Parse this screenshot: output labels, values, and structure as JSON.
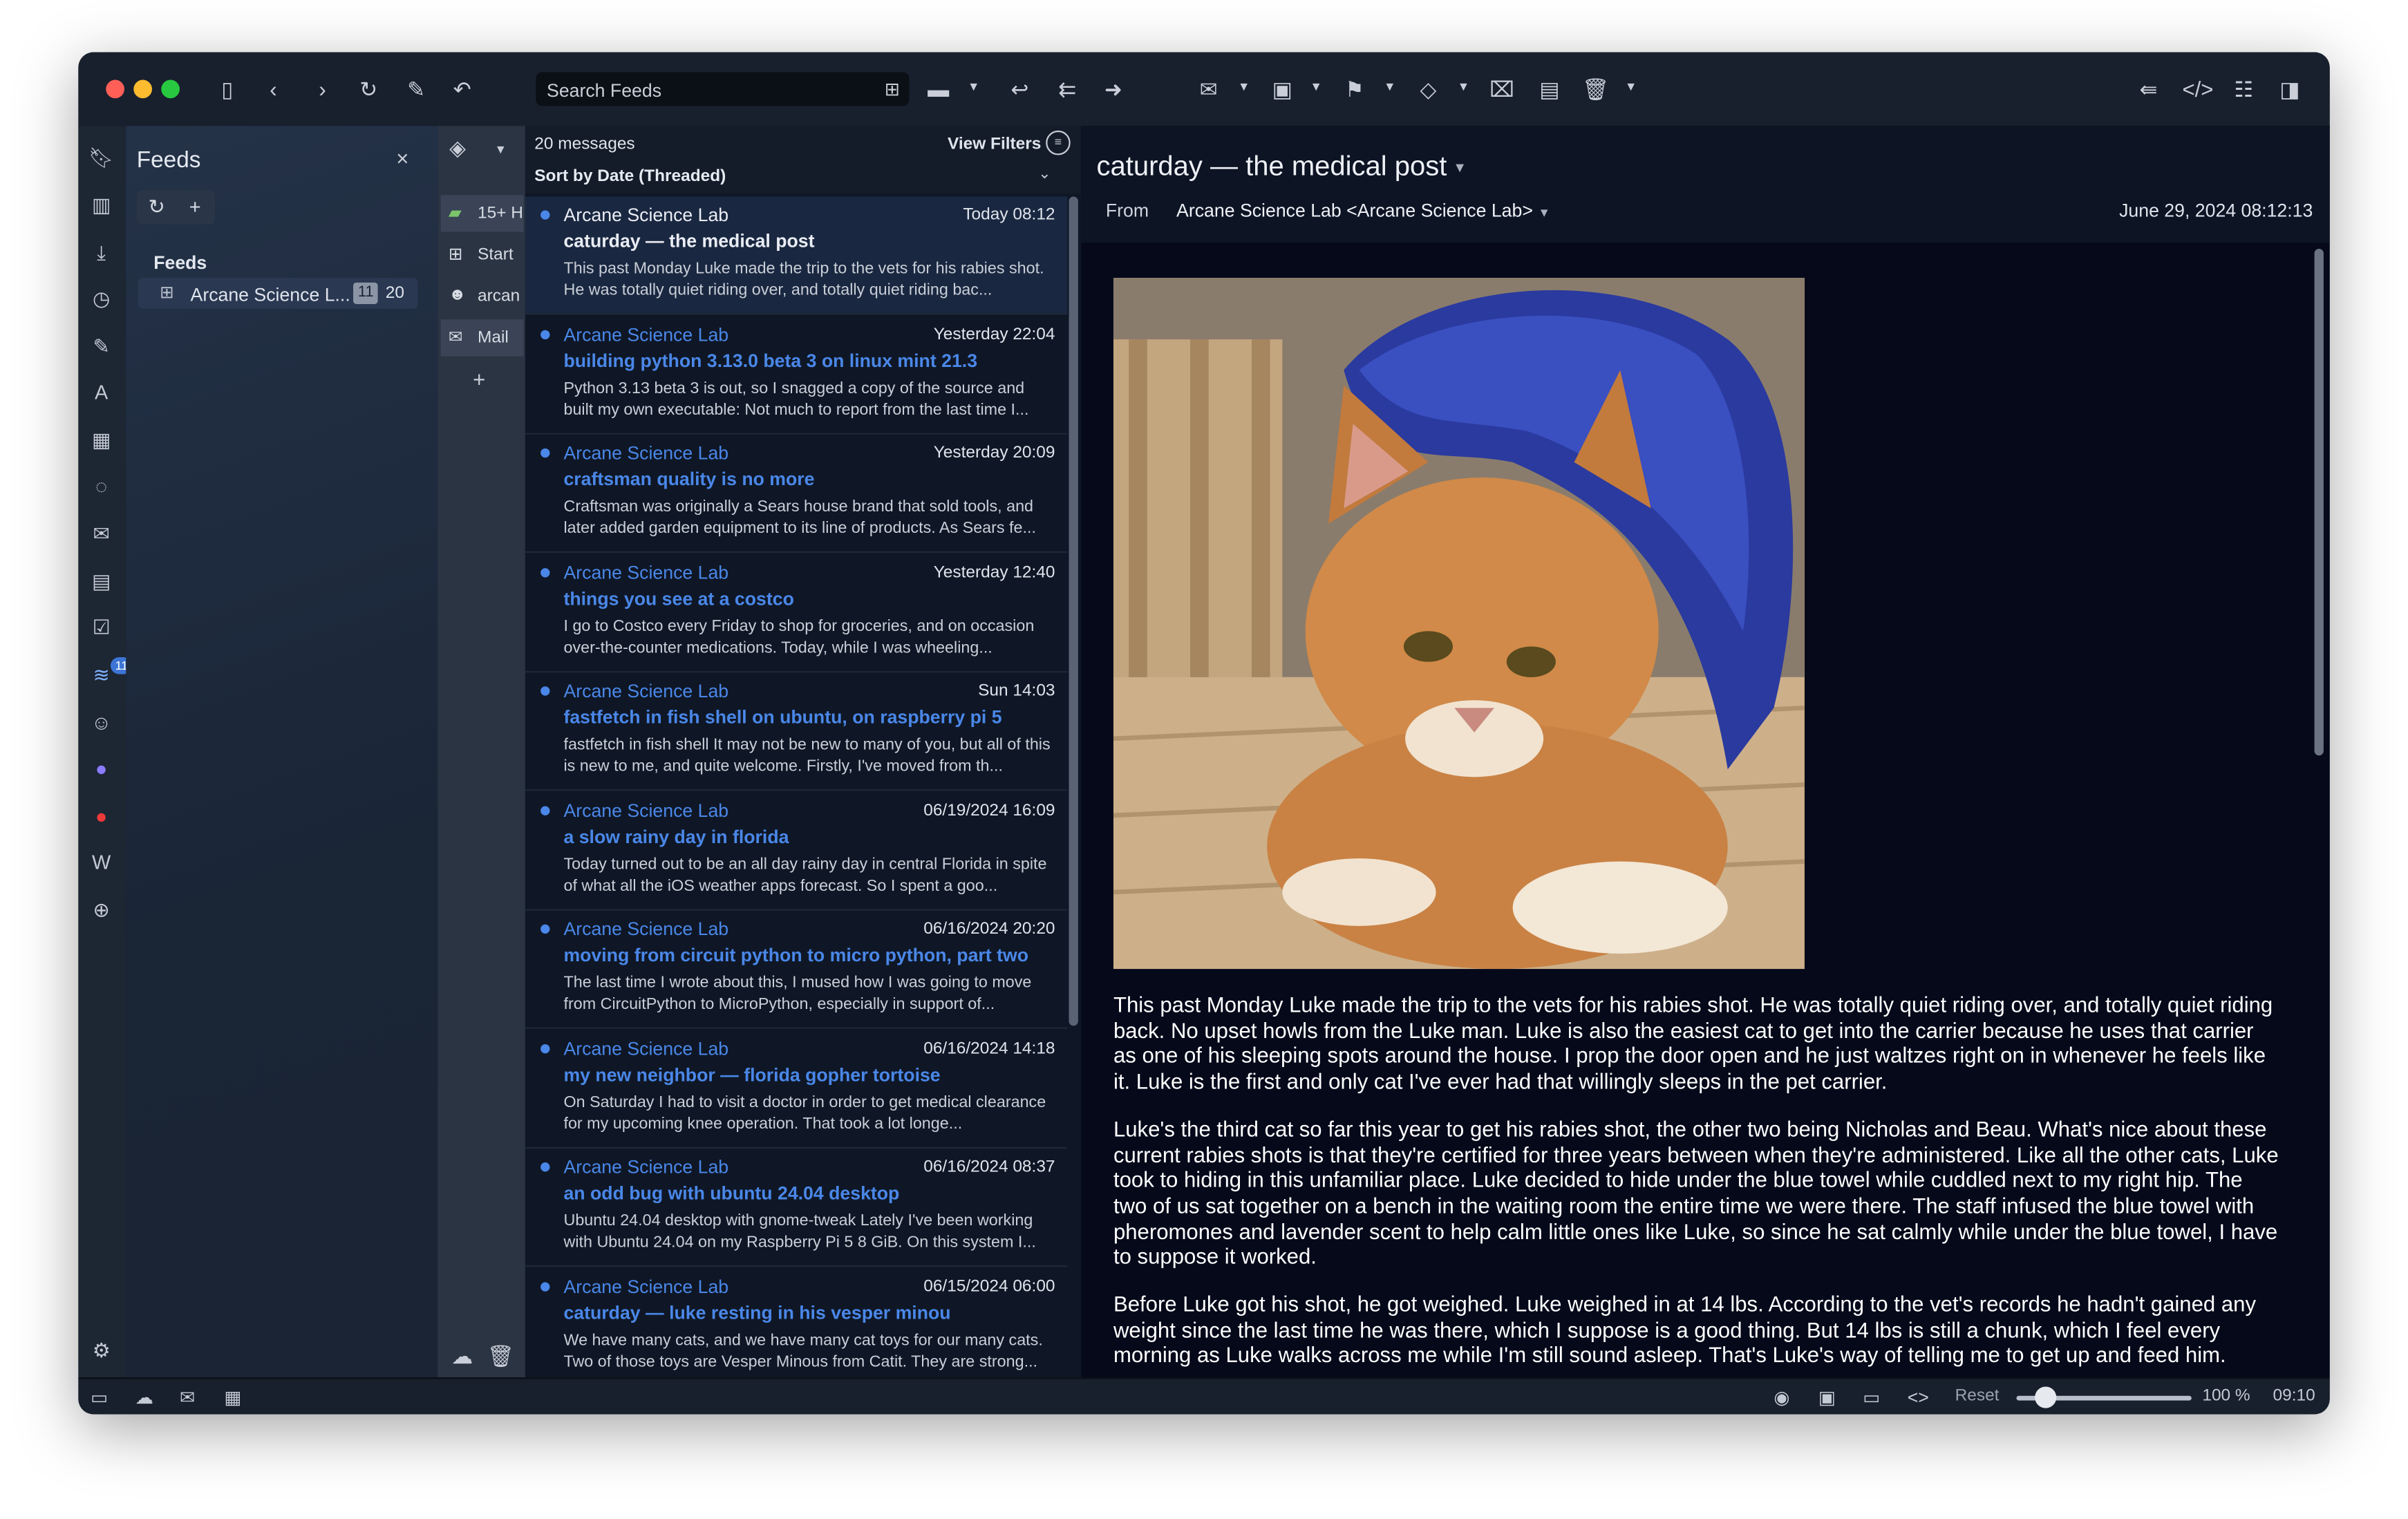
{
  "toolbar": {
    "search_placeholder": "Search Feeds"
  },
  "colors": {
    "accent": "#4a87e8",
    "close": "#ff5f57",
    "minimize": "#febc2e",
    "zoom": "#28c840"
  },
  "panel": {
    "title": "Feeds",
    "section_label": "Feeds",
    "feed_name": "Arcane Science L...",
    "unread_count": "11",
    "total_count": "20"
  },
  "iconbar": {
    "feed_badge": "11"
  },
  "workspaces": [
    {
      "label": "15+ H"
    },
    {
      "label": "Start"
    },
    {
      "label": "arcan"
    },
    {
      "label": "Mail"
    }
  ],
  "list": {
    "count": "20 messages",
    "view_filters": "View Filters",
    "sort": "Sort by Date (Threaded)",
    "messages": [
      {
        "sender": "Arcane Science Lab",
        "date": "Today 08:12",
        "subject": "caturday — the medical post",
        "snippet": "This past Monday Luke made the trip to the vets for his rabies shot. He was totally quiet riding over, and totally quiet riding bac..."
      },
      {
        "sender": "Arcane Science Lab",
        "date": "Yesterday 22:04",
        "subject": "building python 3.13.0 beta 3 on linux mint 21.3",
        "snippet": "Python 3.13 beta 3 is out, so I snagged a copy of the source and built my own executable: Not much to report from the last time I..."
      },
      {
        "sender": "Arcane Science Lab",
        "date": "Yesterday 20:09",
        "subject": "craftsman quality is no more",
        "snippet": "Craftsman was originally a Sears house brand that sold tools, and later added garden equipment to its line of products. As Sears fe..."
      },
      {
        "sender": "Arcane Science Lab",
        "date": "Yesterday 12:40",
        "subject": "things you see at a costco",
        "snippet": "I go to Costco every Friday to shop for groceries, and on occasion over-the-counter medications. Today, while I was wheeling..."
      },
      {
        "sender": "Arcane Science Lab",
        "date": "Sun 14:03",
        "subject": "fastfetch in fish shell on ubuntu, on raspberry pi 5",
        "snippet": "fastfetch in fish shell It may not be new to many of you, but all of this is new to me, and quite welcome. Firstly, I've moved from th..."
      },
      {
        "sender": "Arcane Science Lab",
        "date": "06/19/2024 16:09",
        "subject": "a slow rainy day in florida",
        "snippet": "Today turned out to be an all day rainy day in central Florida in spite of what all the iOS weather apps forecast. So I spent a goo..."
      },
      {
        "sender": "Arcane Science Lab",
        "date": "06/16/2024 20:20",
        "subject": "moving from circuit python to micro python, part two",
        "snippet": "The last time I wrote about this, I mused how I was going to move from CircuitPython to MicroPython, especially in support of..."
      },
      {
        "sender": "Arcane Science Lab",
        "date": "06/16/2024 14:18",
        "subject": "my new neighbor — florida gopher tortoise",
        "snippet": "On Saturday I had to visit a doctor in order to get medical clearance for my upcoming knee operation. That took a lot longe..."
      },
      {
        "sender": "Arcane Science Lab",
        "date": "06/16/2024 08:37",
        "subject": "an odd bug with ubuntu 24.04 desktop",
        "snippet": "Ubuntu 24.04 desktop with gnome-tweak Lately I've been working with Ubuntu 24.04 on my Raspberry Pi 5 8 GiB. On this system I..."
      },
      {
        "sender": "Arcane Science Lab",
        "date": "06/15/2024 06:00",
        "subject": "caturday — luke resting in his vesper minou",
        "snippet": "We have many cats, and we have many cat toys for our many cats. Two of those toys are Vesper Minous from Catit. They are strong..."
      }
    ]
  },
  "reader": {
    "title": "caturday — the medical post",
    "from_label": "From",
    "sender": "Arcane Science Lab <Arcane Science Lab>",
    "date": "June 29, 2024 08:12:13",
    "paragraphs": [
      "This past Monday Luke made the trip to the vets for his rabies shot. He was totally quiet riding over, and totally quiet riding back. No upset howls from the Luke man. Luke is also the easiest cat to get into the carrier because he uses that carrier as one of his sleeping spots around the house. I prop the door open and he just waltzes right on in whenever he feels like it. Luke is the first and only cat I've ever had that willingly sleeps in the pet carrier.",
      "Luke's the third cat so far this year to get his rabies shot, the other two being Nicholas and Beau. What's nice about these current rabies shots is that they're certified for three years between when they're administered. Like all the other cats, Luke took to hiding in this unfamiliar place. Luke decided to hide under the blue towel while cuddled next to my right hip. The two of us sat together on a bench in the waiting room the entire time we were there. The staff infused the blue towel with pheromones and lavender scent to help calm little ones like Luke, so since he sat calmly while under the blue towel, I have to suppose it worked.",
      "Before Luke got his shot, he got weighed. Luke weighed in at 14 lbs. According to the vet's records he hadn't gained any weight since the last time he was there, which I suppose is a good thing. But 14 lbs is still a chunk, which I feel every morning as Luke walks across me while I'm still sound asleep. That's Luke's way of telling me to get up and feed him."
    ]
  },
  "status": {
    "reset": "Reset",
    "zoom": "100 %",
    "time": "09:10"
  }
}
